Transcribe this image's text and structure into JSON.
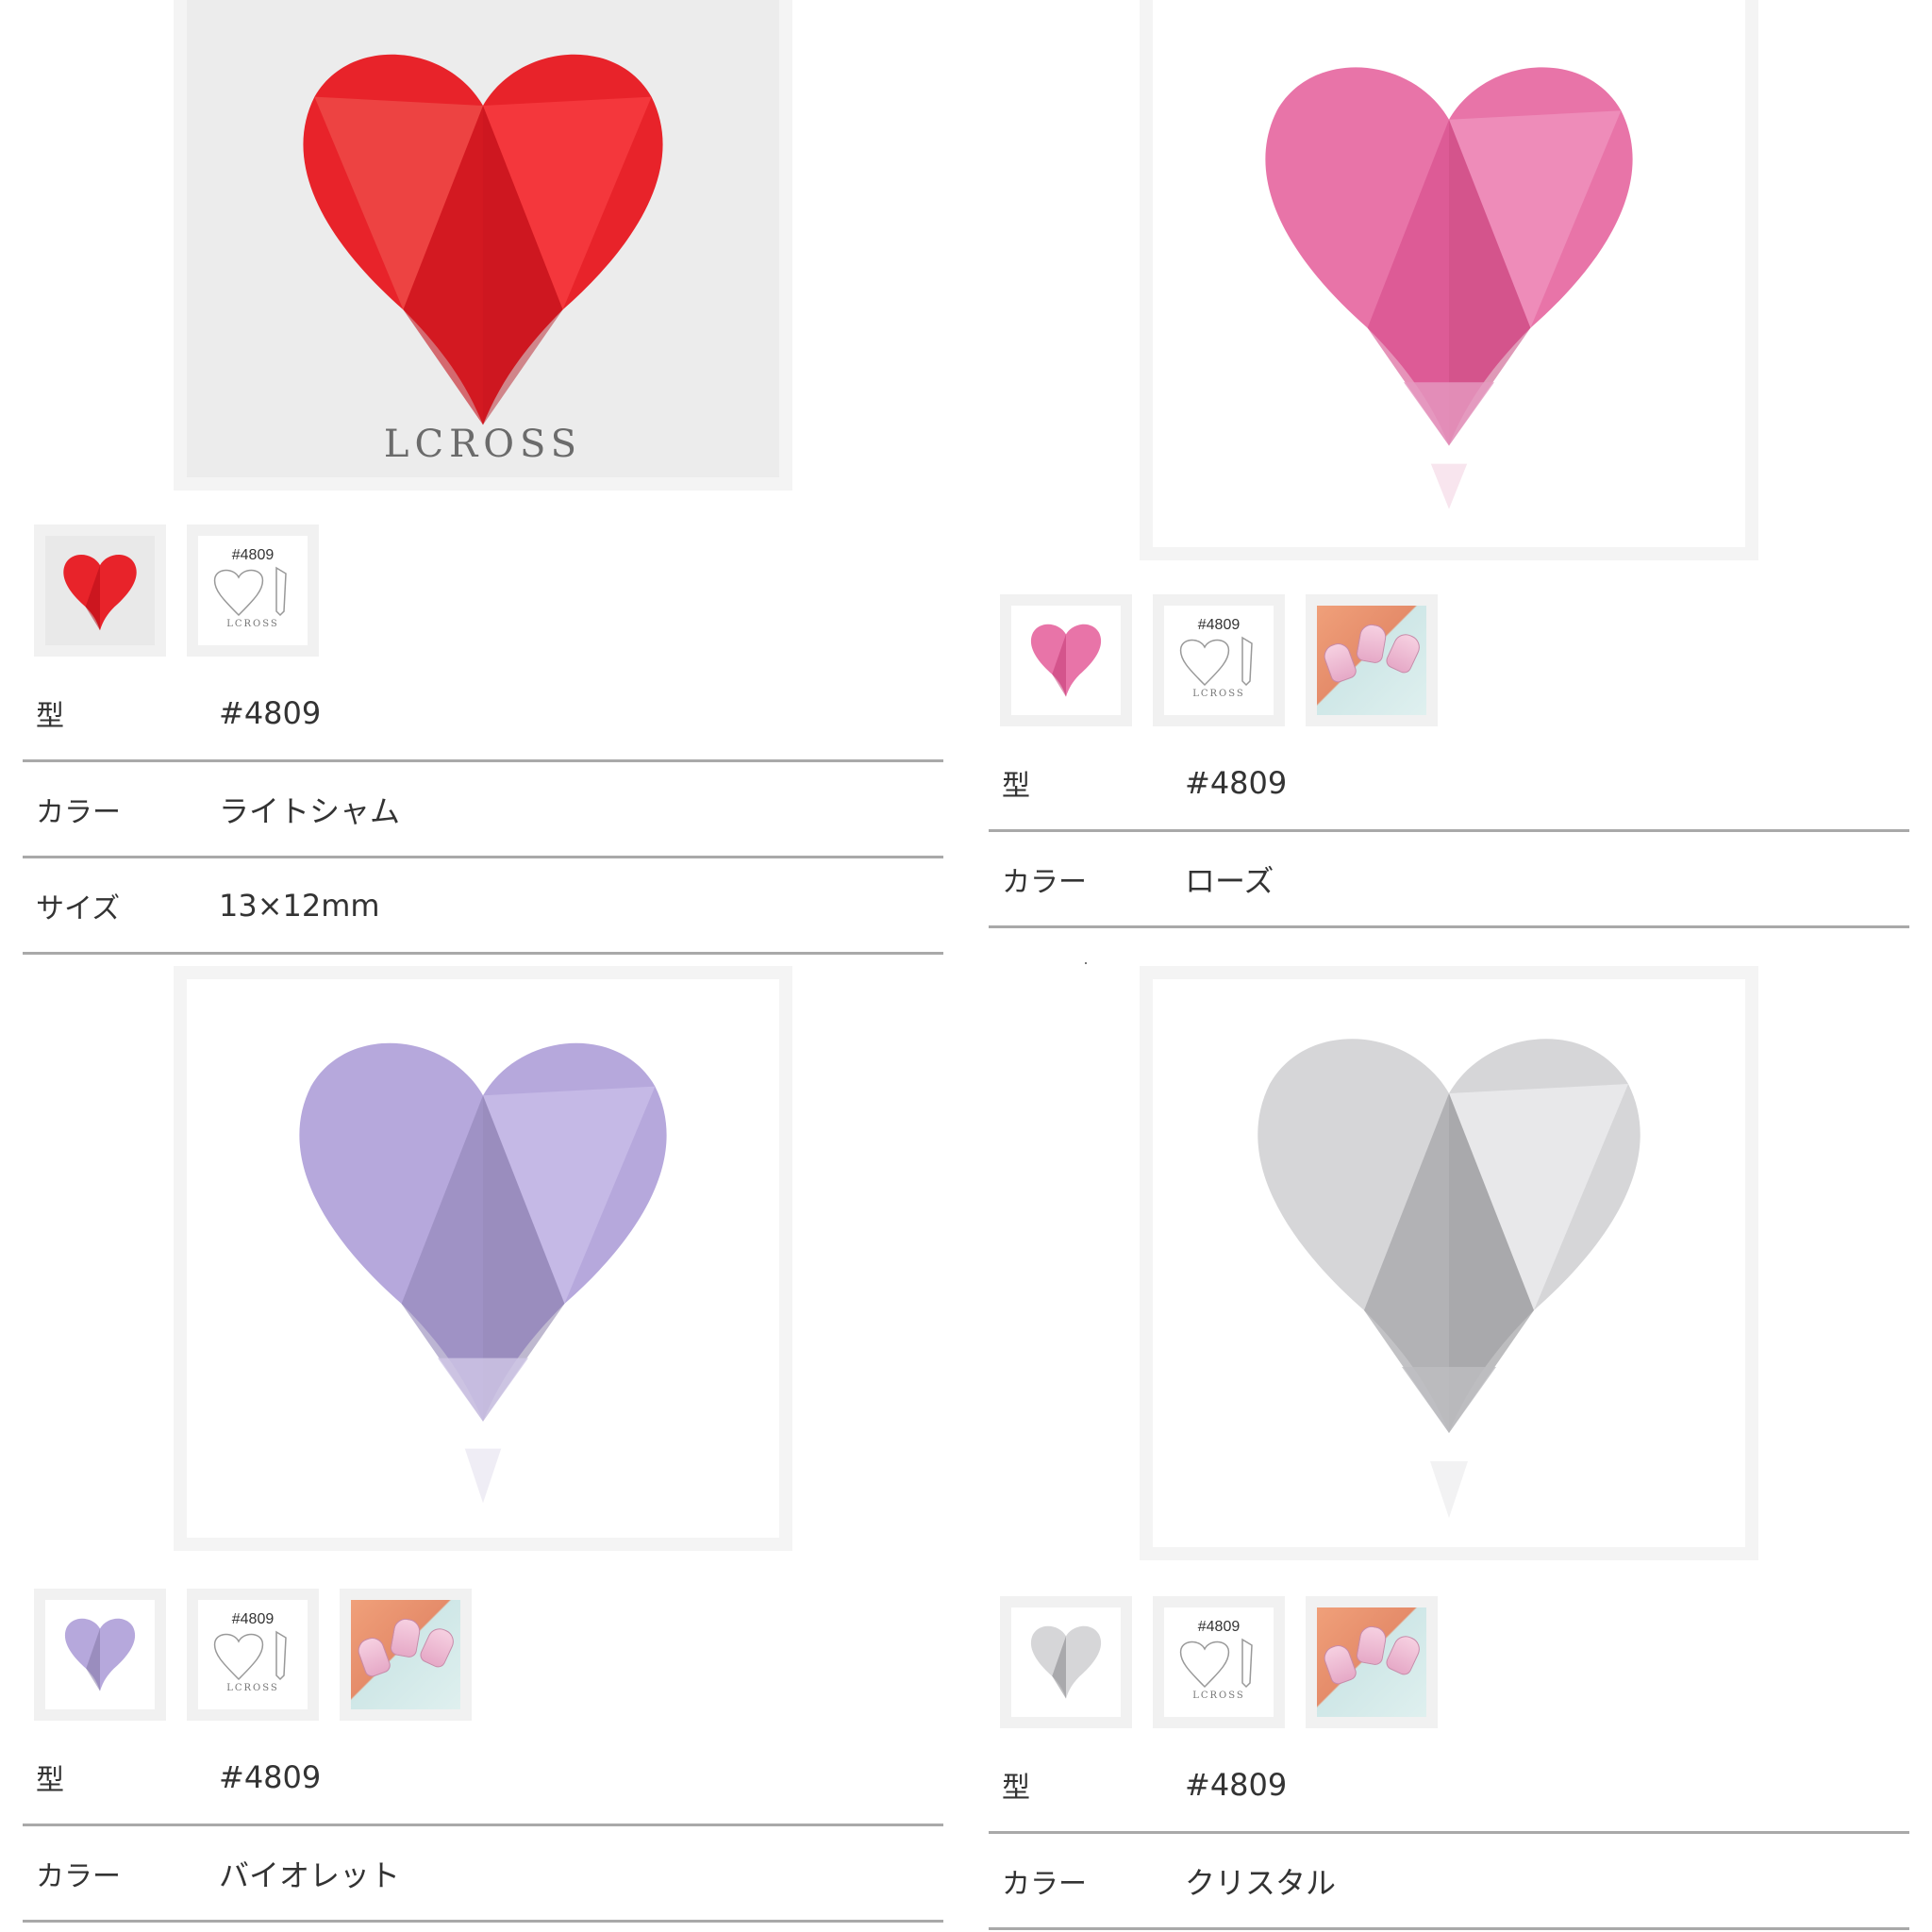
{
  "watermark": "LCROSS",
  "products": [
    {
      "id": "red",
      "color_hex": "#e8232a",
      "thumb_model": "#4809",
      "thumb_brand": "LCROSS",
      "specs": [
        {
          "label": "型",
          "value": "#4809"
        },
        {
          "label": "カラー",
          "value": "ライトシャム"
        },
        {
          "label": "サイズ",
          "value": "13×12mm"
        }
      ]
    },
    {
      "id": "rose",
      "color_hex": "#e874a8",
      "thumb_model": "#4809",
      "thumb_brand": "LCROSS",
      "specs": [
        {
          "label": "型",
          "value": "#4809"
        },
        {
          "label": "カラー",
          "value": "ローズ"
        }
      ]
    },
    {
      "id": "violet",
      "color_hex": "#b6a8dc",
      "thumb_model": "#4809",
      "thumb_brand": "LCROSS",
      "specs": [
        {
          "label": "型",
          "value": "#4809"
        },
        {
          "label": "カラー",
          "value": "バイオレット"
        }
      ]
    },
    {
      "id": "crystal",
      "color_hex": "#d6d6d8",
      "thumb_model": "#4809",
      "thumb_brand": "LCROSS",
      "specs": [
        {
          "label": "型",
          "value": "#4809"
        },
        {
          "label": "カラー",
          "value": "クリスタル"
        }
      ]
    }
  ]
}
